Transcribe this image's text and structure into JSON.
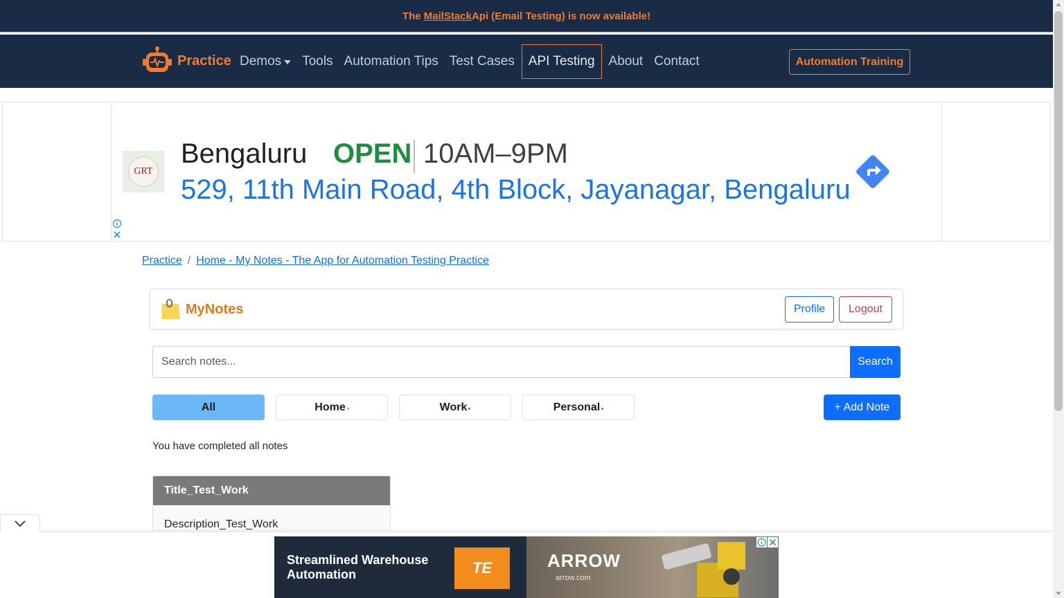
{
  "top_banner": {
    "prefix": "The ",
    "link": "MailStack",
    "suffix": " Api (Email Testing) is now available!"
  },
  "navbar": {
    "brand": "Practice",
    "items": [
      {
        "label": "Demos"
      },
      {
        "label": "Tools"
      },
      {
        "label": "Automation Tips"
      },
      {
        "label": "Test Cases"
      },
      {
        "label": "API Testing"
      },
      {
        "label": "About"
      },
      {
        "label": "Contact"
      }
    ],
    "training_button": "Automation Training"
  },
  "ad": {
    "logo_text": "GRT",
    "city": "Bengaluru",
    "status": "OPEN",
    "hours": "10AM–9PM",
    "address": "529, 11th Main Road, 4th Block, Jayanagar, Bengaluru"
  },
  "breadcrumb": {
    "items": [
      "Practice",
      "Home - My Notes - The App for Automation Testing Practice"
    ],
    "separator": "/"
  },
  "notes_header": {
    "title": "MyNotes",
    "profile_button": "Profile",
    "logout_button": "Logout"
  },
  "search": {
    "placeholder": "Search notes...",
    "button": "Search"
  },
  "tabs": [
    {
      "label": "All"
    },
    {
      "label": "Home",
      "dot_color": "#f0a500"
    },
    {
      "label": "Work",
      "dot_color": "#3c78d8"
    },
    {
      "label": "Personal",
      "dot_color": "#3c78d8"
    }
  ],
  "add_note_button": "+ Add Note",
  "status_message": "You have completed all notes",
  "notes": [
    {
      "title": "Title_Test_Work",
      "description": "Description_Test_Work"
    }
  ],
  "bottom_ad": {
    "headline_line1": "Streamlined Warehouse",
    "headline_line2": "Automation",
    "te_logo": "TE",
    "brand": "ARROW",
    "brand_url": "arrow.com"
  },
  "colors": {
    "navy": "#1a2b45",
    "accent_orange": "#f07d2e",
    "primary_blue": "#0d6efd",
    "danger_red": "#dc3545",
    "active_tab": "#6bb7f8"
  }
}
